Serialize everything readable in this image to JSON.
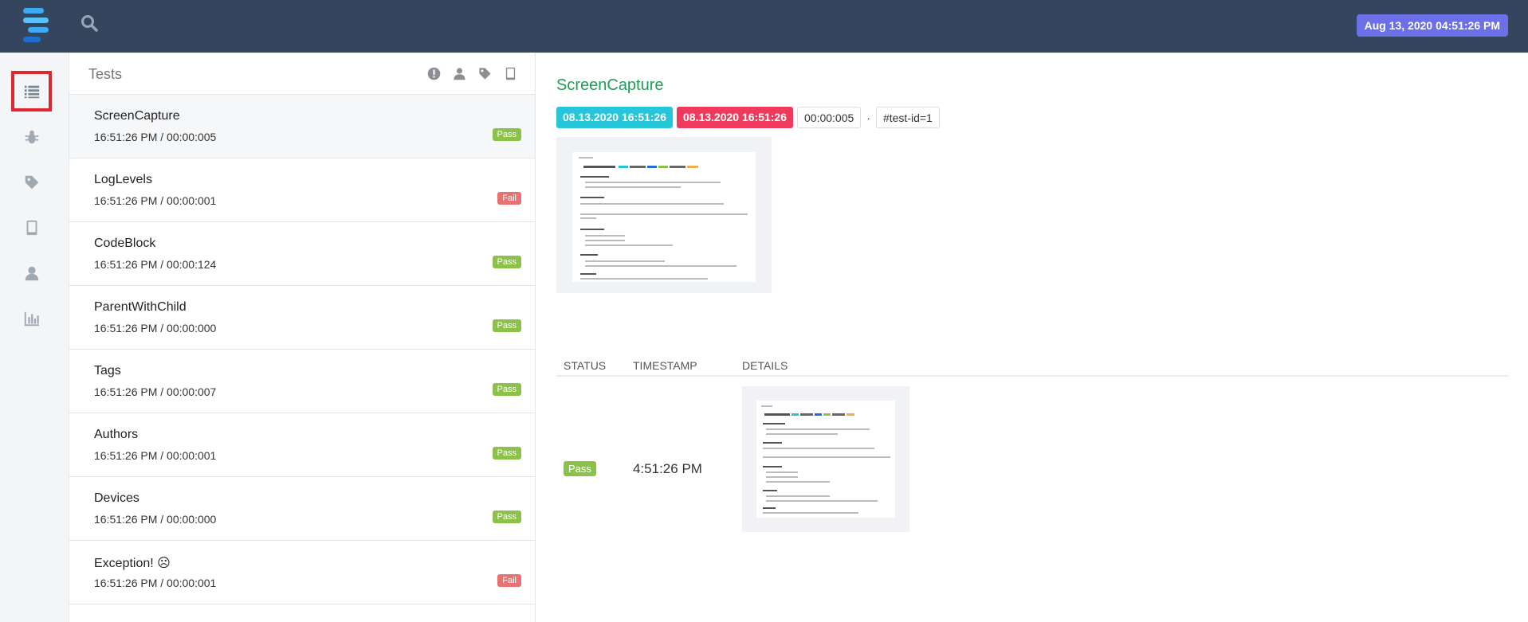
{
  "topbar": {
    "datetime": "Aug 13, 2020 04:51:26 PM",
    "logo_colors": [
      "#3fa9f5",
      "#1e6fd0",
      "#5bc0ff"
    ]
  },
  "sidenav": {
    "items": [
      {
        "name": "tests-list",
        "icon": "list-icon",
        "active": true
      },
      {
        "name": "bugs",
        "icon": "bug-icon",
        "active": false
      },
      {
        "name": "tags",
        "icon": "tag-icon",
        "active": false
      },
      {
        "name": "devices",
        "icon": "tablet-icon",
        "active": false
      },
      {
        "name": "authors",
        "icon": "user-icon",
        "active": false
      },
      {
        "name": "dashboard",
        "icon": "bar-chart-icon",
        "active": false
      }
    ]
  },
  "tests_panel": {
    "title": "Tests",
    "filter_icons": [
      "exclamation-icon",
      "user-icon",
      "tag-icon",
      "tablet-icon"
    ],
    "items": [
      {
        "name": "ScreenCapture",
        "time": "16:51:26 PM / 00:00:005",
        "status": "Pass"
      },
      {
        "name": "LogLevels",
        "time": "16:51:26 PM / 00:00:001",
        "status": "Fail"
      },
      {
        "name": "CodeBlock",
        "time": "16:51:26 PM / 00:00:124",
        "status": "Pass"
      },
      {
        "name": "ParentWithChild",
        "time": "16:51:26 PM / 00:00:000",
        "status": "Pass"
      },
      {
        "name": "Tags",
        "time": "16:51:26 PM / 00:00:007",
        "status": "Pass"
      },
      {
        "name": "Authors",
        "time": "16:51:26 PM / 00:00:001",
        "status": "Pass"
      },
      {
        "name": "Devices",
        "time": "16:51:26 PM / 00:00:000",
        "status": "Pass"
      },
      {
        "name": "Exception! ☹",
        "time": "16:51:26 PM / 00:00:001",
        "status": "Fail"
      }
    ]
  },
  "detail": {
    "title": "ScreenCapture",
    "start": "08.13.2020 16:51:26",
    "end": "08.13.2020 16:51:26",
    "duration": "00:00:005",
    "separator": "·",
    "test_id": "#test-id=1",
    "table": {
      "headers": [
        "STATUS",
        "TIMESTAMP",
        "DETAILS"
      ],
      "row": {
        "status": "Pass",
        "timestamp": "4:51:26 PM"
      }
    }
  },
  "colors": {
    "topbar": "#34455e",
    "pass": "#8bc34a",
    "fail": "#e57373",
    "title_green": "#1e9d57",
    "badge_start": "#26c6da",
    "badge_end": "#ef3a5d",
    "date_badge": "#6b6fe8",
    "active_outline": "#e0262e"
  }
}
